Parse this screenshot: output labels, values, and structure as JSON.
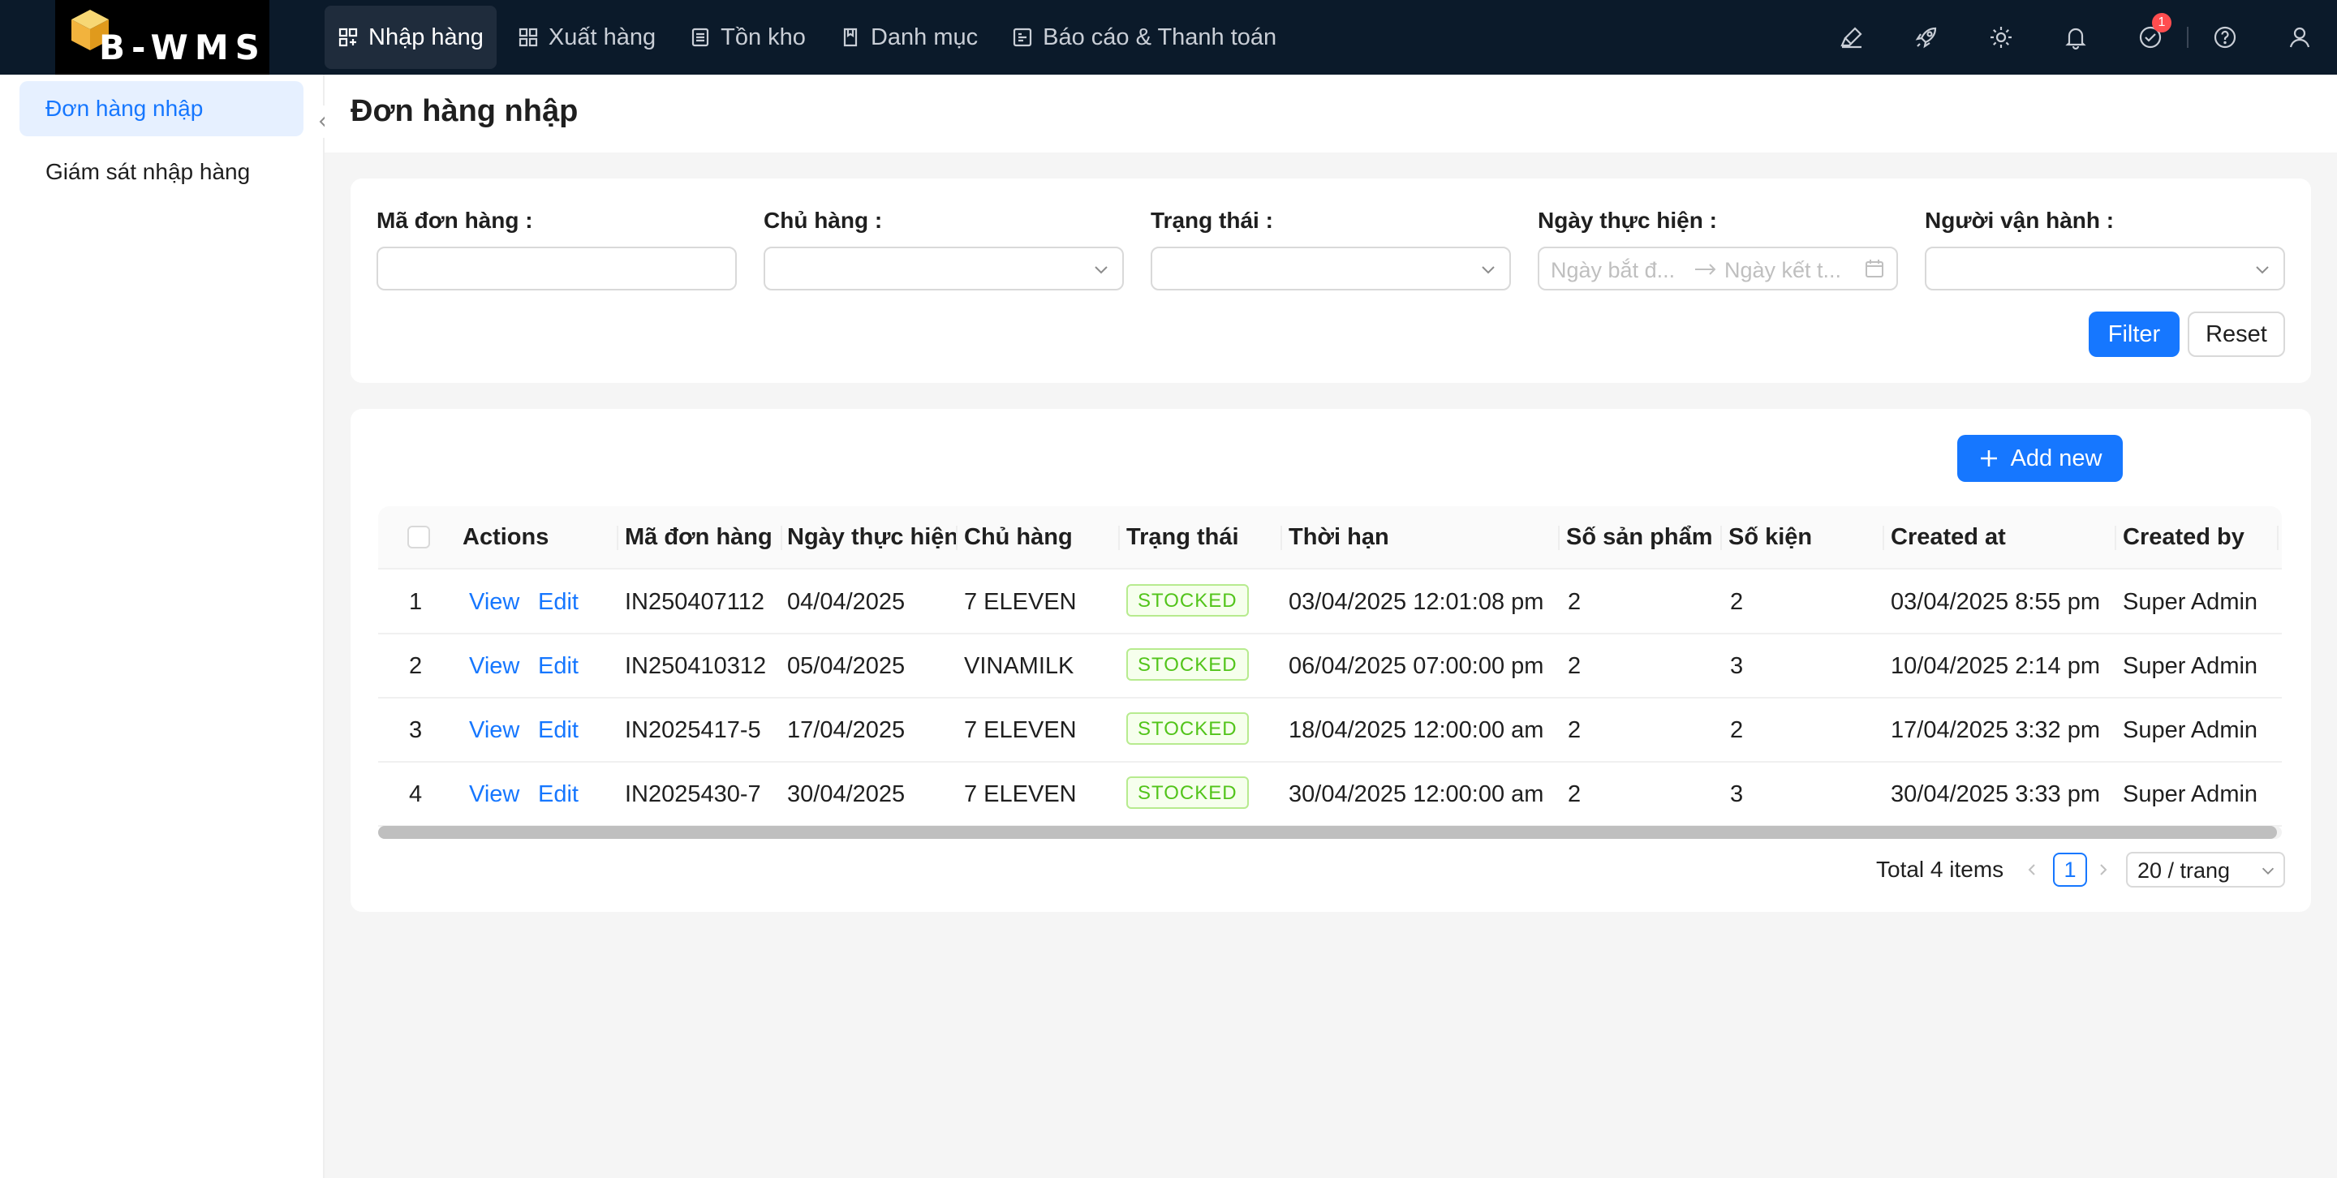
{
  "brand": {
    "logo_text": "B-WMS"
  },
  "nav": [
    {
      "label": "Nhập hàng",
      "icon": "inbound-icon",
      "active": true
    },
    {
      "label": "Xuất hàng",
      "icon": "outbound-icon"
    },
    {
      "label": "Tồn kho",
      "icon": "inventory-icon"
    },
    {
      "label": "Danh mục",
      "icon": "catalog-icon"
    },
    {
      "label": "Báo cáo & Thanh toán",
      "icon": "report-icon"
    }
  ],
  "topbar_icons": [
    "highlighter-icon",
    "rocket-icon",
    "gear-icon",
    "bell-icon",
    "task-check-icon",
    "help-icon",
    "user-icon"
  ],
  "task_badge": "1",
  "sidebar": {
    "items": [
      {
        "label": "Đơn hàng nhập",
        "active": true
      },
      {
        "label": "Giám sát nhập hàng"
      }
    ]
  },
  "page": {
    "title": "Đơn hàng nhập"
  },
  "filters": {
    "order_code_label": "Mã đơn hàng :",
    "owner_label": "Chủ hàng :",
    "status_label": "Trạng thái :",
    "date_label": "Ngày thực hiện :",
    "date_start_placeholder": "Ngày bắt đ...",
    "date_end_placeholder": "Ngày kết t...",
    "operator_label": "Người vận hành :",
    "filter_button": "Filter",
    "reset_button": "Reset"
  },
  "table": {
    "add_new": "Add new",
    "columns": [
      "Actions",
      "Mã đơn hàng",
      "Ngày thực hiện",
      "Chủ hàng",
      "Trạng thái",
      "Thời hạn",
      "Số sản phẩm",
      "Số kiện",
      "Created at",
      "Created by"
    ],
    "rows": [
      {
        "index": "1",
        "view": "View",
        "edit": "Edit",
        "code": "IN250407112",
        "date": "04/04/2025",
        "owner": "7 ELEVEN",
        "status": "STOCKED",
        "deadline": "03/04/2025 12:01:08 pm",
        "products": "2",
        "packages": "2",
        "created_at": "03/04/2025 8:55 pm",
        "created_by": "Super Admin"
      },
      {
        "index": "2",
        "view": "View",
        "edit": "Edit",
        "code": "IN250410312",
        "date": "05/04/2025",
        "owner": "VINAMILK",
        "status": "STOCKED",
        "deadline": "06/04/2025 07:00:00 pm",
        "products": "2",
        "packages": "3",
        "created_at": "10/04/2025 2:14 pm",
        "created_by": "Super Admin"
      },
      {
        "index": "3",
        "view": "View",
        "edit": "Edit",
        "code": "IN2025417-5",
        "date": "17/04/2025",
        "owner": "7 ELEVEN",
        "status": "STOCKED",
        "deadline": "18/04/2025 12:00:00 am",
        "products": "2",
        "packages": "2",
        "created_at": "17/04/2025 3:32 pm",
        "created_by": "Super Admin"
      },
      {
        "index": "4",
        "view": "View",
        "edit": "Edit",
        "code": "IN2025430-7",
        "date": "30/04/2025",
        "owner": "7 ELEVEN",
        "status": "STOCKED",
        "deadline": "30/04/2025 12:00:00 am",
        "products": "2",
        "packages": "3",
        "created_at": "30/04/2025 3:33 pm",
        "created_by": "Super Admin"
      }
    ]
  },
  "pagination": {
    "total": "Total 4 items",
    "current": "1",
    "page_size": "20 / trang"
  },
  "colors": {
    "primary": "#1677ff",
    "topbar": "#0b1a2a",
    "success": "#52c41a",
    "badge": "#ff4d4f"
  }
}
